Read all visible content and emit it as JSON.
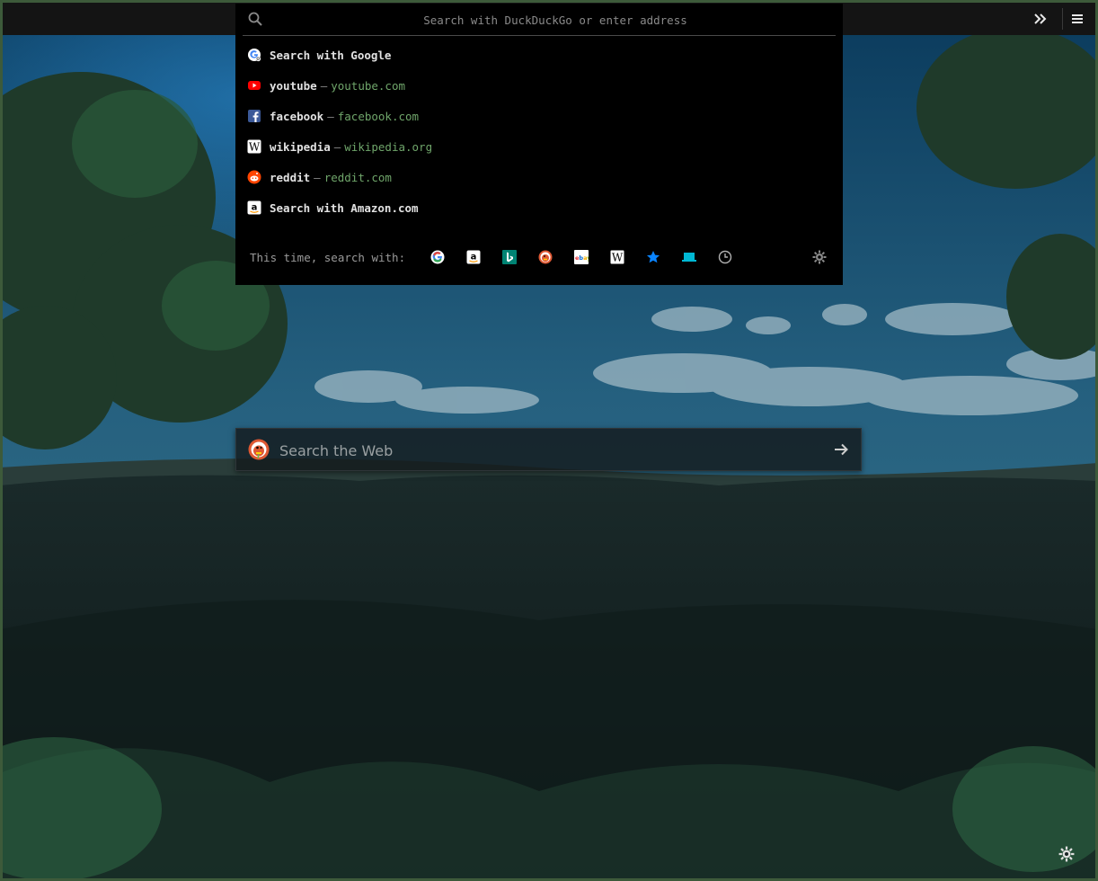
{
  "urlbar": {
    "placeholder": "Search with DuckDuckGo or enter address",
    "icon": "search-icon"
  },
  "toolbar": {
    "overflow_icon": "double-chevron-right-icon",
    "menu_icon": "hamburger-menu-icon"
  },
  "suggestions": [
    {
      "type": "search",
      "title": "Search with Google",
      "icon": "google-search-icon"
    },
    {
      "type": "site",
      "title": "youtube",
      "dash": "—",
      "url": "youtube.com",
      "icon": "youtube-icon"
    },
    {
      "type": "site",
      "title": "facebook",
      "dash": "—",
      "url": "facebook.com",
      "icon": "facebook-icon"
    },
    {
      "type": "site",
      "title": "wikipedia",
      "dash": "—",
      "url": "wikipedia.org",
      "icon": "wikipedia-icon"
    },
    {
      "type": "site",
      "title": "reddit",
      "dash": "—",
      "url": "reddit.com",
      "icon": "reddit-icon"
    },
    {
      "type": "search",
      "title": "Search with Amazon.com",
      "icon": "amazon-icon"
    }
  ],
  "engine_bar": {
    "label": "This time, search with:",
    "engines": [
      "google-icon",
      "amazon-icon",
      "bing-icon",
      "duckduckgo-icon",
      "ebay-icon",
      "wikipedia-icon",
      "bookmarks-star-icon",
      "tabs-icon",
      "history-icon"
    ],
    "settings_icon": "gear-icon"
  },
  "web_search": {
    "placeholder": "Search the Web",
    "engine_icon": "duckduckgo-icon",
    "go_icon": "arrow-right-icon"
  },
  "colors": {
    "accent_green": "#6fa56a",
    "frame": "#3d5a3a"
  }
}
